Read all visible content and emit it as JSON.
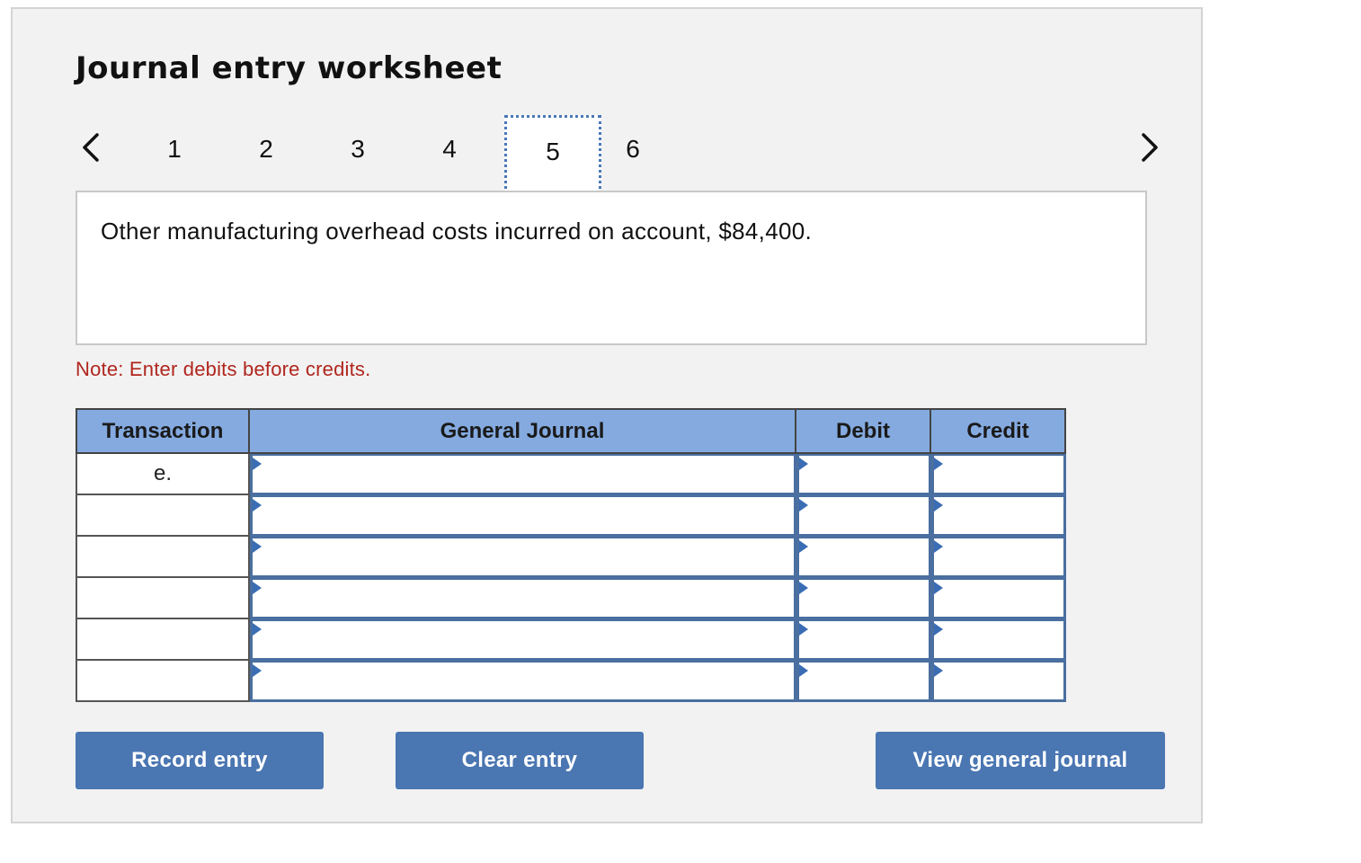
{
  "worksheet": {
    "title": "Journal entry worksheet",
    "steps": [
      "1",
      "2",
      "3",
      "4",
      "5",
      "6"
    ],
    "active_step": "5",
    "description": "Other manufacturing overhead costs incurred on account, $84,400.",
    "note": "Note: Enter debits before credits."
  },
  "table": {
    "headers": {
      "transaction": "Transaction",
      "general_journal": "General Journal",
      "debit": "Debit",
      "credit": "Credit"
    },
    "rows": [
      {
        "transaction": "e.",
        "account": "",
        "debit": "",
        "credit": ""
      },
      {
        "transaction": "",
        "account": "",
        "debit": "",
        "credit": ""
      },
      {
        "transaction": "",
        "account": "",
        "debit": "",
        "credit": ""
      },
      {
        "transaction": "",
        "account": "",
        "debit": "",
        "credit": ""
      },
      {
        "transaction": "",
        "account": "",
        "debit": "",
        "credit": ""
      },
      {
        "transaction": "",
        "account": "",
        "debit": "",
        "credit": ""
      }
    ]
  },
  "buttons": {
    "record": "Record entry",
    "clear": "Clear entry",
    "view": "View general journal"
  },
  "icons": {
    "prev": "chevron-left-icon",
    "next": "chevron-right-icon",
    "dropdown": "dropdown-triangle-icon"
  },
  "colors": {
    "header_bg": "#84aae0",
    "button_bg": "#4a76b2",
    "note_text": "#b0261e",
    "input_border": "#4a6fa0",
    "active_step_border": "#4a78b8"
  }
}
